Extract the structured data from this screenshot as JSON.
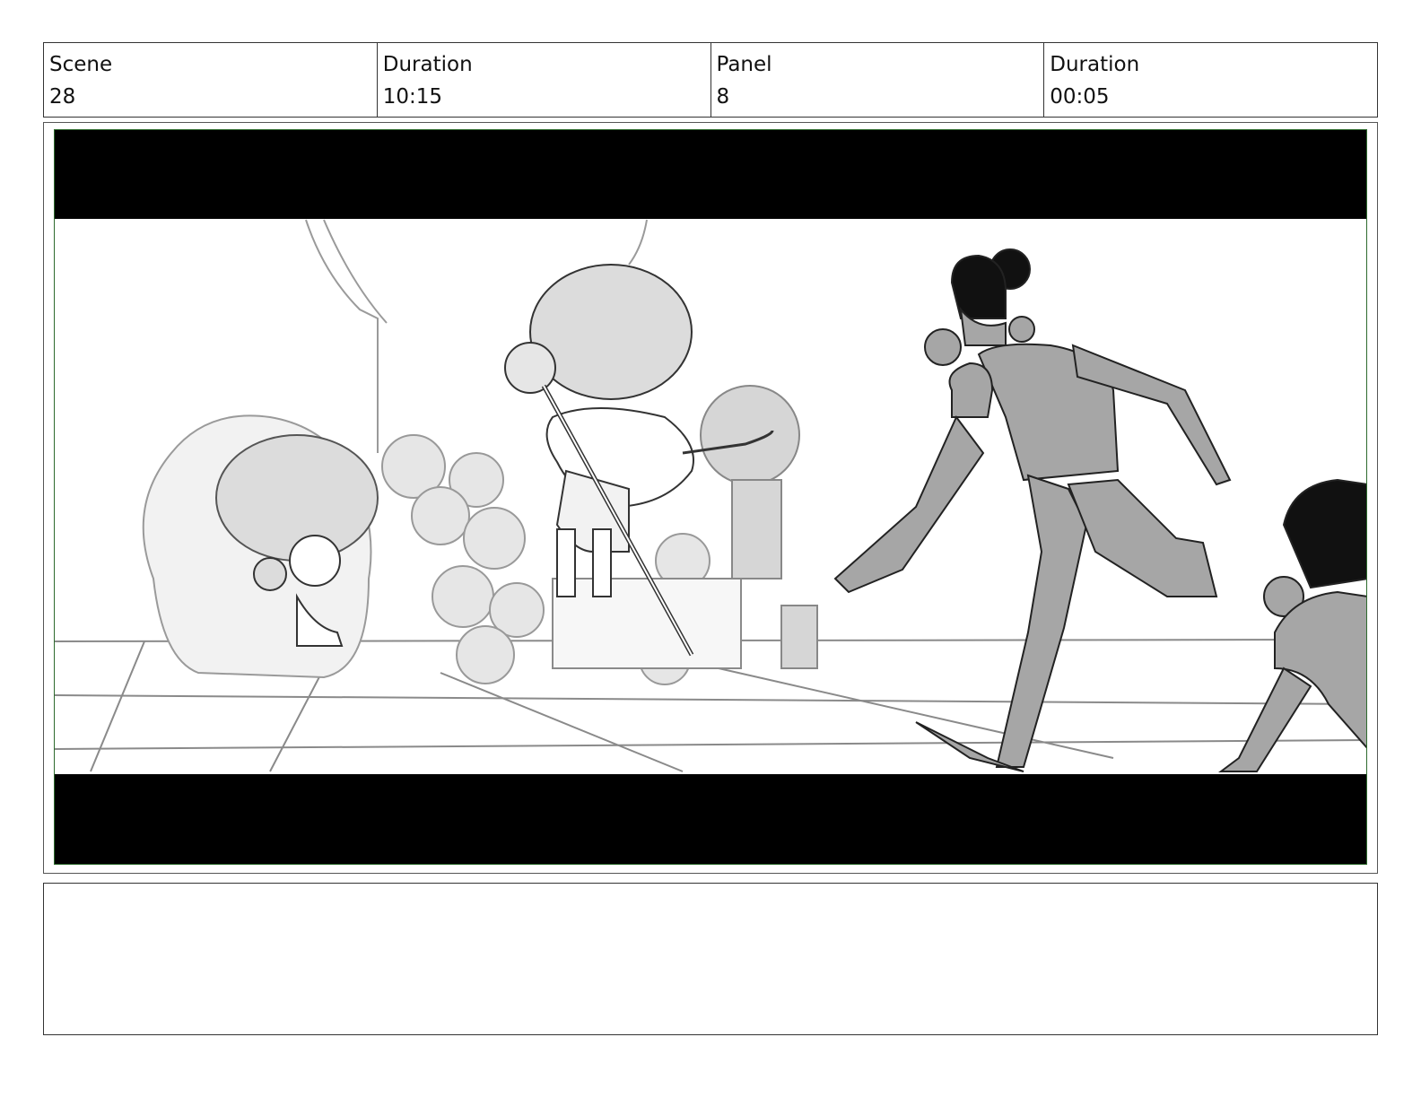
{
  "header": {
    "scene_label": "Scene",
    "scene_value": "28",
    "scene_duration_label": "Duration",
    "scene_duration_value": "10:15",
    "panel_label": "Panel",
    "panel_value": "8",
    "panel_duration_label": "Duration",
    "panel_duration_value": "00:05"
  },
  "notes": {
    "text": ""
  },
  "colors": {
    "frame_border": "#2e6b2e",
    "letterbox": "#000000",
    "sketch_fill": "#a6a6a6",
    "sketch_light": "#d9d9d9"
  }
}
